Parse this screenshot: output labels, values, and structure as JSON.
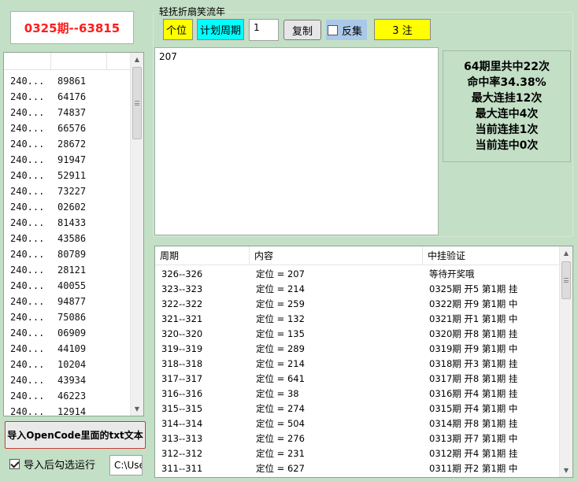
{
  "issue_display": "0325期--63815",
  "left_list": {
    "rows": [
      {
        "period": "240...",
        "code": "89861"
      },
      {
        "period": "240...",
        "code": "64176"
      },
      {
        "period": "240...",
        "code": "74837"
      },
      {
        "period": "240...",
        "code": "66576"
      },
      {
        "period": "240...",
        "code": "28672"
      },
      {
        "period": "240...",
        "code": "91947"
      },
      {
        "period": "240...",
        "code": "52911"
      },
      {
        "period": "240...",
        "code": "73227"
      },
      {
        "period": "240...",
        "code": "02602"
      },
      {
        "period": "240...",
        "code": "81433"
      },
      {
        "period": "240...",
        "code": "43586"
      },
      {
        "period": "240...",
        "code": "80789"
      },
      {
        "period": "240...",
        "code": "28121"
      },
      {
        "period": "240...",
        "code": "40055"
      },
      {
        "period": "240...",
        "code": "94877"
      },
      {
        "period": "240...",
        "code": "75086"
      },
      {
        "period": "240...",
        "code": "06909"
      },
      {
        "period": "240...",
        "code": "44109"
      },
      {
        "period": "240...",
        "code": "10204"
      },
      {
        "period": "240...",
        "code": "43934"
      },
      {
        "period": "240...",
        "code": "46223"
      },
      {
        "period": "240...",
        "code": "12914"
      }
    ]
  },
  "import_button_label": "导入OpenCode里面的txt文本",
  "auto_run": {
    "label": "导入后勾选运行",
    "checked": true
  },
  "path_field_value": "C:\\Use",
  "group": {
    "title": "轻抚折扇笑流年",
    "position_chip": "个位",
    "plan_chip": "计划周期",
    "plan_value": "1",
    "copy_label": "复制",
    "reverse_label": "反集",
    "count_chip": "3 注",
    "text_content": "207"
  },
  "stats": [
    "64期里共中22次",
    "命中率34.38%",
    "最大连挂12次",
    "最大连中4次",
    "当前连挂1次",
    "当前连中0次"
  ],
  "results": {
    "headers": [
      "周期",
      "内容",
      "中挂验证"
    ],
    "rows": [
      [
        "326--326",
        "定位 = 207",
        "等待开奖哦"
      ],
      [
        "323--323",
        "定位 = 214",
        "0325期 开5 第1期 挂"
      ],
      [
        "322--322",
        "定位 = 259",
        "0322期 开9 第1期 中"
      ],
      [
        "321--321",
        "定位 = 132",
        "0321期 开1 第1期 中"
      ],
      [
        "320--320",
        "定位 = 135",
        "0320期 开8 第1期 挂"
      ],
      [
        "319--319",
        "定位 = 289",
        "0319期 开9 第1期 中"
      ],
      [
        "318--318",
        "定位 = 214",
        "0318期 开3 第1期 挂"
      ],
      [
        "317--317",
        "定位 = 641",
        "0317期 开8 第1期 挂"
      ],
      [
        "316--316",
        "定位 = 38",
        "0316期 开4 第1期 挂"
      ],
      [
        "315--315",
        "定位 = 274",
        "0315期 开4 第1期 中"
      ],
      [
        "314--314",
        "定位 = 504",
        "0314期 开8 第1期 挂"
      ],
      [
        "313--313",
        "定位 = 276",
        "0313期 开7 第1期 中"
      ],
      [
        "312--312",
        "定位 = 231",
        "0312期 开4 第1期 挂"
      ],
      [
        "311--311",
        "定位 = 627",
        "0311期 开2 第1期 中"
      ]
    ]
  },
  "colors": {
    "background": "#c3dfc6",
    "issue_text": "#ff1c1c",
    "chip_yellow": "#ffff00",
    "chip_cyan": "#00ffff",
    "reverse_bg": "#aac8e8",
    "import_border": "#c9342f"
  },
  "icons": [
    "scroll-up-arrow-icon",
    "scroll-down-arrow-icon",
    "scroll-grip-icon",
    "checkbox-icon"
  ]
}
